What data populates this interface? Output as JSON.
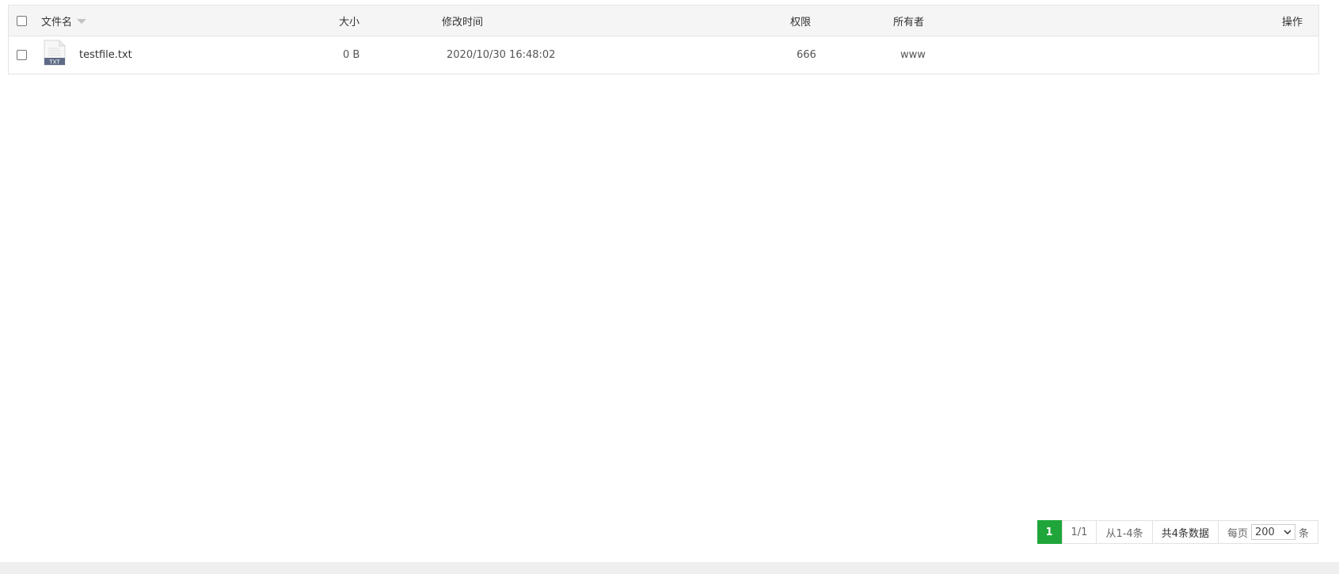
{
  "table": {
    "headers": {
      "name": "文件名",
      "size": "大小",
      "mtime": "修改时间",
      "perm": "权限",
      "owner": "所有者",
      "actions": "操作"
    },
    "rows": [
      {
        "name": "testfile.txt",
        "icon": "txt-file-icon",
        "icon_label": "TXT",
        "size": "0 B",
        "mtime": "2020/10/30 16:48:02",
        "perm": "666",
        "owner": "www"
      }
    ]
  },
  "pagination": {
    "current_page": "1",
    "page_of": "1/1",
    "range": "从1-4条",
    "total": "共4条数据",
    "per_page_label": "每页",
    "per_page_value": "200",
    "per_page_unit": "条",
    "active_color": "#20a53a"
  }
}
